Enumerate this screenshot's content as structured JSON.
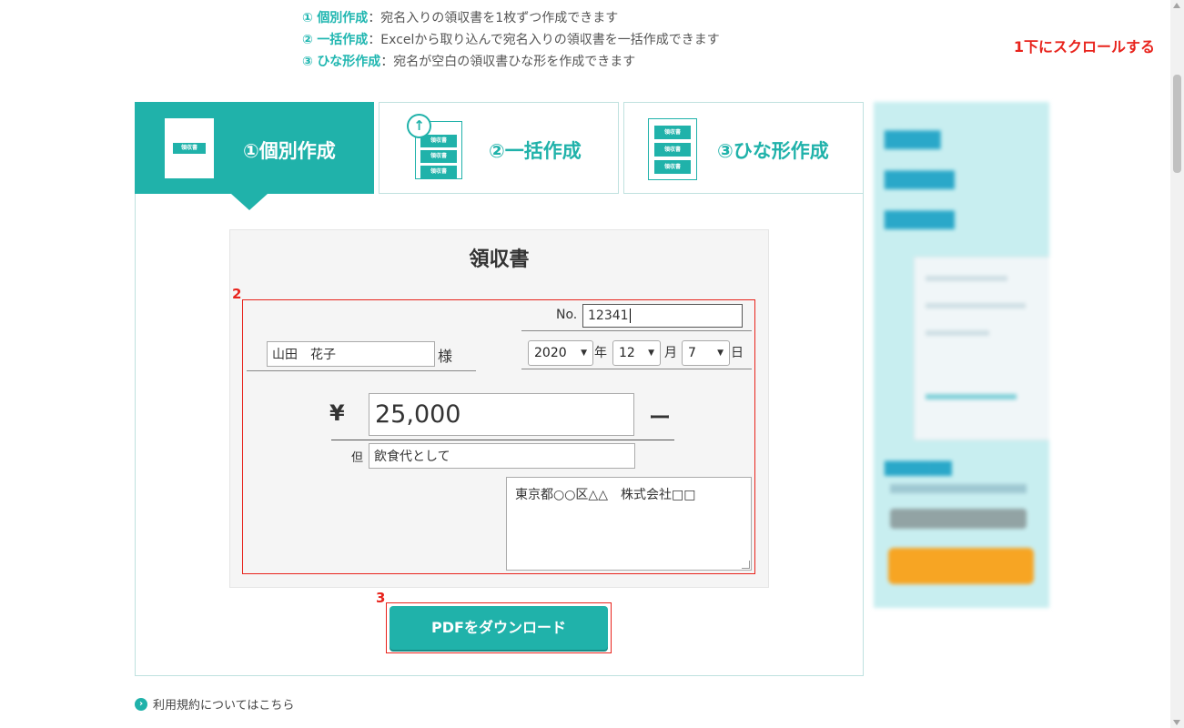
{
  "intro": {
    "lines": [
      {
        "num": "①",
        "keyword": "個別作成",
        "text": "：宛名入りの領収書を1枚ずつ作成できます"
      },
      {
        "num": "②",
        "keyword": "一括作成",
        "text": "：Excelから取り込んで宛名入りの領収書を一括作成できます"
      },
      {
        "num": "③",
        "keyword": "ひな形作成",
        "text": "：宛名が空白の領収書ひな形を作成できます"
      }
    ]
  },
  "annotations": {
    "scroll": "1下にスクロールする",
    "two": "2",
    "three": "3"
  },
  "tabs": [
    {
      "label": "①個別作成",
      "icon_text": "領収書",
      "active": true
    },
    {
      "label": "②一括作成",
      "icon_text": "領収書",
      "active": false
    },
    {
      "label": "③ひな形作成",
      "icon_text": "領収書",
      "active": false
    }
  ],
  "receipt": {
    "title": "領収書",
    "no_label": "No.",
    "no_value": "12341",
    "recipient_value": "山田　花子",
    "recipient_suffix": "様",
    "year": "2020",
    "year_label": "年",
    "month": "12",
    "month_label": "月",
    "day": "7",
    "day_label": "日",
    "yen": "¥",
    "amount": "25,000",
    "amount_suffix": "ー",
    "tadashi_label": "但",
    "tadashi_value": "飲食代として",
    "issuer": "東京都○○区△△　株式会社□□"
  },
  "download_label": "PDFをダウンロード",
  "terms_label": "利用規約についてはこちら",
  "colors": {
    "accent": "#20b2aa",
    "annotation": "#e8231c"
  }
}
